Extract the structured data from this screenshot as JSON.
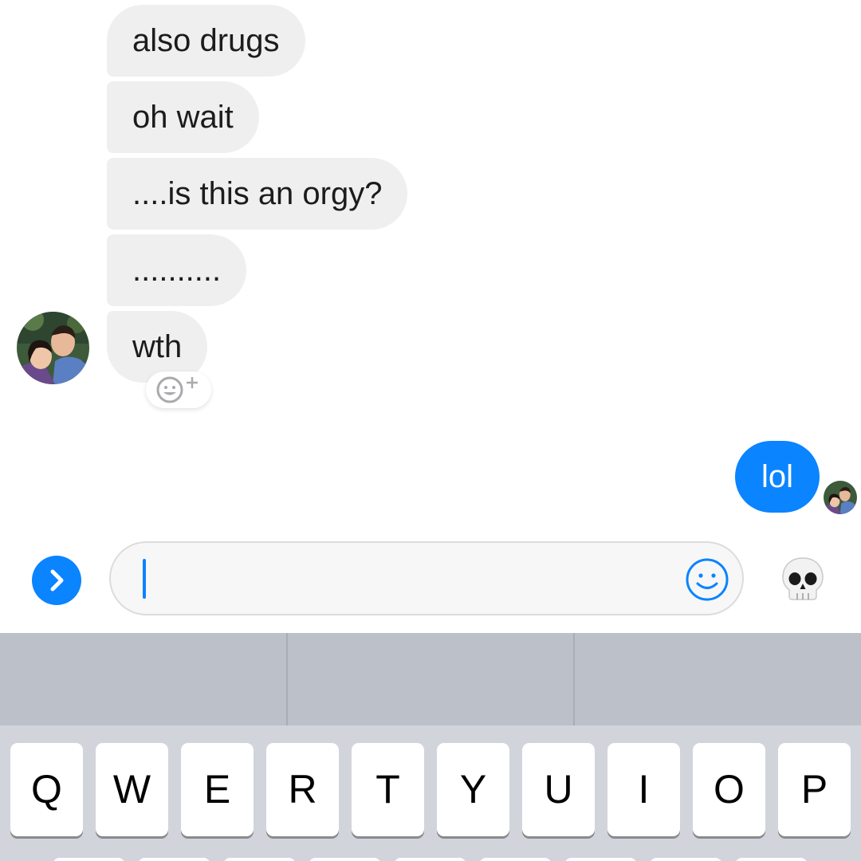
{
  "conversation": {
    "incoming_messages": [
      {
        "text": "also drugs"
      },
      {
        "text": "oh wait"
      },
      {
        "text": "....is this an orgy?"
      },
      {
        "text": ".........."
      },
      {
        "text": "wth"
      }
    ],
    "outgoing_messages": [
      {
        "text": "lol"
      }
    ]
  },
  "composer": {
    "value": "",
    "quick_emoji": "💀",
    "quick_emoji_name": "skull-emoji"
  },
  "keyboard": {
    "suggestions": [
      "",
      "",
      ""
    ],
    "top_row": [
      "Q",
      "W",
      "E",
      "R",
      "T",
      "Y",
      "U",
      "I",
      "O",
      "P"
    ]
  },
  "colors": {
    "accent": "#0a84ff",
    "incoming_bubble": "#efefef",
    "predictive_bar": "#bcc1c9",
    "keyboard_bg": "#d1d4da"
  }
}
